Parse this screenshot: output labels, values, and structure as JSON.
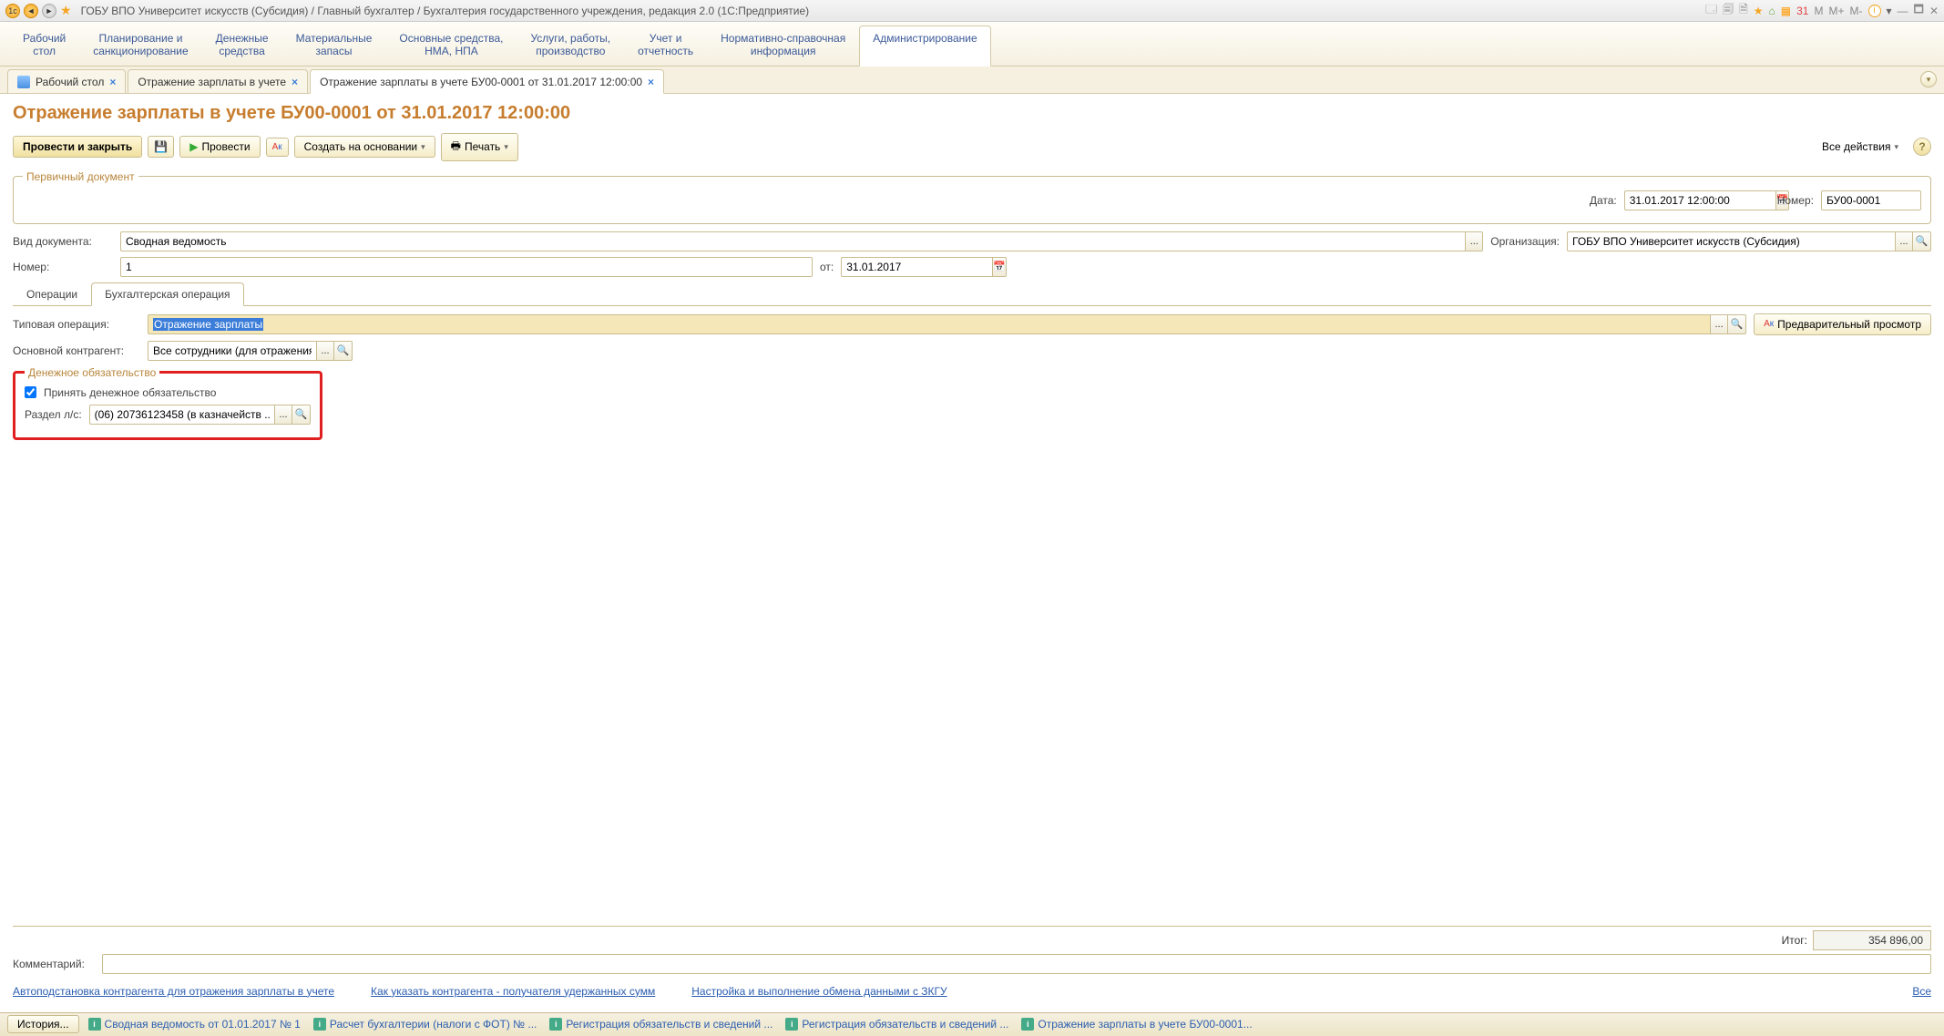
{
  "titlebar": {
    "title": "ГОБУ ВПО Университет искусств (Субсидия) / Главный бухгалтер / Бухгалтерия государственного учреждения, редакция 2.0  (1С:Предприятие)",
    "right_labels": {
      "m1": "М",
      "m2": "М+",
      "m3": "М-"
    }
  },
  "sections": [
    "Рабочий\nстол",
    "Планирование и\nсанкционирование",
    "Денежные\nсредства",
    "Материальные\nзапасы",
    "Основные средства,\nНМА, НПА",
    "Услуги, работы,\nпроизводство",
    "Учет и\nотчетность",
    "Нормативно-справочная\nинформация",
    "Администрирование"
  ],
  "section_active": 8,
  "doc_tabs": [
    {
      "label": "Рабочий стол",
      "has_icon": true
    },
    {
      "label": "Отражение зарплаты в учете"
    },
    {
      "label": "Отражение зарплаты в учете БУ00-0001 от 31.01.2017 12:00:00",
      "active": true
    }
  ],
  "page": {
    "heading": "Отражение зарплаты в учете БУ00-0001 от 31.01.2017 12:00:00"
  },
  "toolbar": {
    "post_close": "Провести и закрыть",
    "post": "Провести",
    "create_based": "Создать на основании",
    "print": "Печать",
    "all_actions": "Все действия"
  },
  "primary_doc": {
    "legend": "Первичный документ",
    "date_label": "Дата:",
    "date_value": "31.01.2017 12:00:00",
    "number_label": "Номер:",
    "number_value": "БУ00-0001"
  },
  "header_fields": {
    "doc_type_label": "Вид документа:",
    "doc_type_value": "Сводная ведомость",
    "org_label": "Организация:",
    "org_value": "ГОБУ ВПО Университет искусств (Субсидия)",
    "number_label": "Номер:",
    "number_value": "1",
    "from_label": "от:",
    "from_value": "31.01.2017"
  },
  "inner_tabs": {
    "operations": "Операции",
    "accounting_op": "Бухгалтерская операция"
  },
  "acc_op": {
    "typical_label": "Типовая операция:",
    "typical_value": "Отражение зарплаты",
    "preview_btn": "Предварительный просмотр",
    "main_contr_label": "Основной контрагент:",
    "main_contr_value": "Все сотрудники (для отражения ...",
    "money_legend": "Денежное обязательство",
    "accept_label": "Принять денежное обязательство",
    "section_label": "Раздел л/с:",
    "section_value": "(06) 20736123458 (в казначейств ..."
  },
  "footer": {
    "total_label": "Итог:",
    "total_value": "354 896,00",
    "comment_label": "Комментарий:"
  },
  "links": {
    "l1": "Автоподстановка контрагента для отражения зарплаты в учете",
    "l2": "Как указать контрагента - получателя удержанных сумм",
    "l3": "Настройка и выполнение обмена данными с ЗКГУ",
    "l4": "Все"
  },
  "statusbar": {
    "history": "История...",
    "items": [
      "Сводная ведомость от 01.01.2017 № 1",
      "Расчет бухгалтерии (налоги с ФОТ) № ...",
      "Регистрация обязательств и сведений ...",
      "Регистрация обязательств и сведений ...",
      "Отражение зарплаты в учете БУ00-0001..."
    ]
  }
}
